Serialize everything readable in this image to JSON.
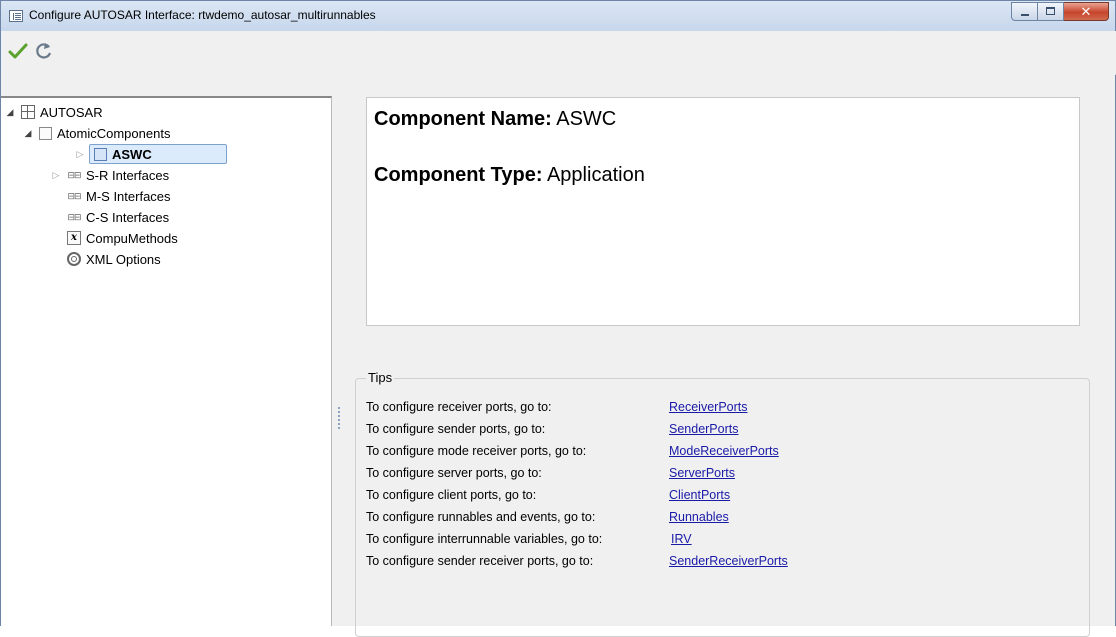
{
  "window": {
    "title": "Configure AUTOSAR Interface: rtwdemo_autosar_multirunnables",
    "close_glyph": "✕"
  },
  "toolbar": {
    "apply_icon": "checkmark-icon",
    "revert_icon": "refresh-icon"
  },
  "tree": {
    "root": "AUTOSAR",
    "atomic_components": "AtomicComponents",
    "aswc": "ASWC",
    "sr_interfaces": "S-R Interfaces",
    "ms_interfaces": "M-S Interfaces",
    "cs_interfaces": "C-S Interfaces",
    "compu_methods": "CompuMethods",
    "xml_options": "XML Options",
    "iface_glyph": "⊟⊟",
    "fx_glyph": "x"
  },
  "component": {
    "name_label": "Component Name:",
    "name_value": "ASWC",
    "type_label": "Component Type:",
    "type_value": "Application"
  },
  "tips": {
    "title": "Tips",
    "rows": [
      {
        "text": "To configure receiver ports, go to:",
        "link": "ReceiverPorts"
      },
      {
        "text": "To configure  sender  ports, go to:",
        "link": "SenderPorts"
      },
      {
        "text": "To configure mode receiver ports, go to:",
        "link": "ModeReceiverPorts"
      },
      {
        "text": "To configure server ports, go to:",
        "link": "ServerPorts"
      },
      {
        "text": "To configure client ports, go to:",
        "link": "ClientPorts"
      },
      {
        "text": "To configure runnables and events, go to:",
        "link": "Runnables"
      },
      {
        "text": "To configure interrunnable variables, go to:",
        "link": "IRV"
      },
      {
        "text": "To configure sender receiver ports, go to:",
        "link": "SenderReceiverPorts"
      }
    ]
  },
  "colors": {
    "link": "#1a1aa8",
    "selection": "#dcebfc",
    "close_button": "#c7442b"
  }
}
